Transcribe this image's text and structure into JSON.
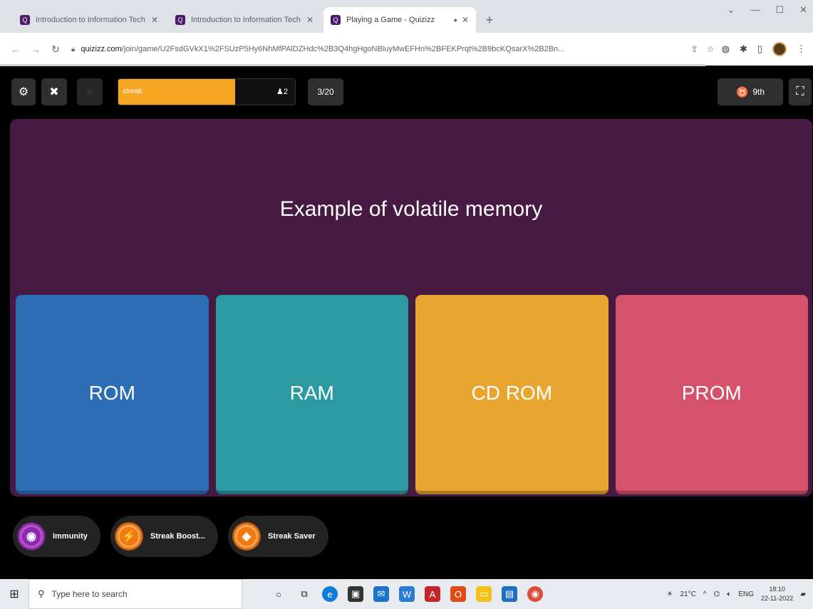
{
  "browser": {
    "tabs": [
      {
        "title": "Introduction to Information Tech",
        "active": false
      },
      {
        "title": "Introduction to Information Tech",
        "active": false
      },
      {
        "title": "Playing a Game - Quizizz",
        "active": true
      }
    ],
    "new_tab": "+",
    "url_domain": "quizizz.com",
    "url_path": "/join/game/U2FsdGVkX1%2FSUzP5Hy6NhMfPAlDZHdc%2B3Q4hgHgoNBluyMwEFHn%2BFEKPrqt%2B9bcKQsarX%2B2Bn..."
  },
  "game": {
    "progress_label": "streak",
    "progress_fraction": 0.66,
    "streak": "2",
    "question_count": "3/20",
    "rank": "9th",
    "question": "Example of volatile memory",
    "options": [
      {
        "label": "ROM",
        "color": "#2d6db5"
      },
      {
        "label": "RAM",
        "color": "#2c9aa1"
      },
      {
        "label": "CD ROM",
        "color": "#e8a630"
      },
      {
        "label": "PROM",
        "color": "#d5536a"
      }
    ],
    "powerups": [
      {
        "label": "Immunity"
      },
      {
        "label": "Streak Boost..."
      },
      {
        "label": "Streak Saver"
      }
    ]
  },
  "taskbar": {
    "search_placeholder": "Type here to search",
    "weather": "21°C",
    "lang": "ENG",
    "time": "18:10",
    "date": "22-11-2022"
  }
}
